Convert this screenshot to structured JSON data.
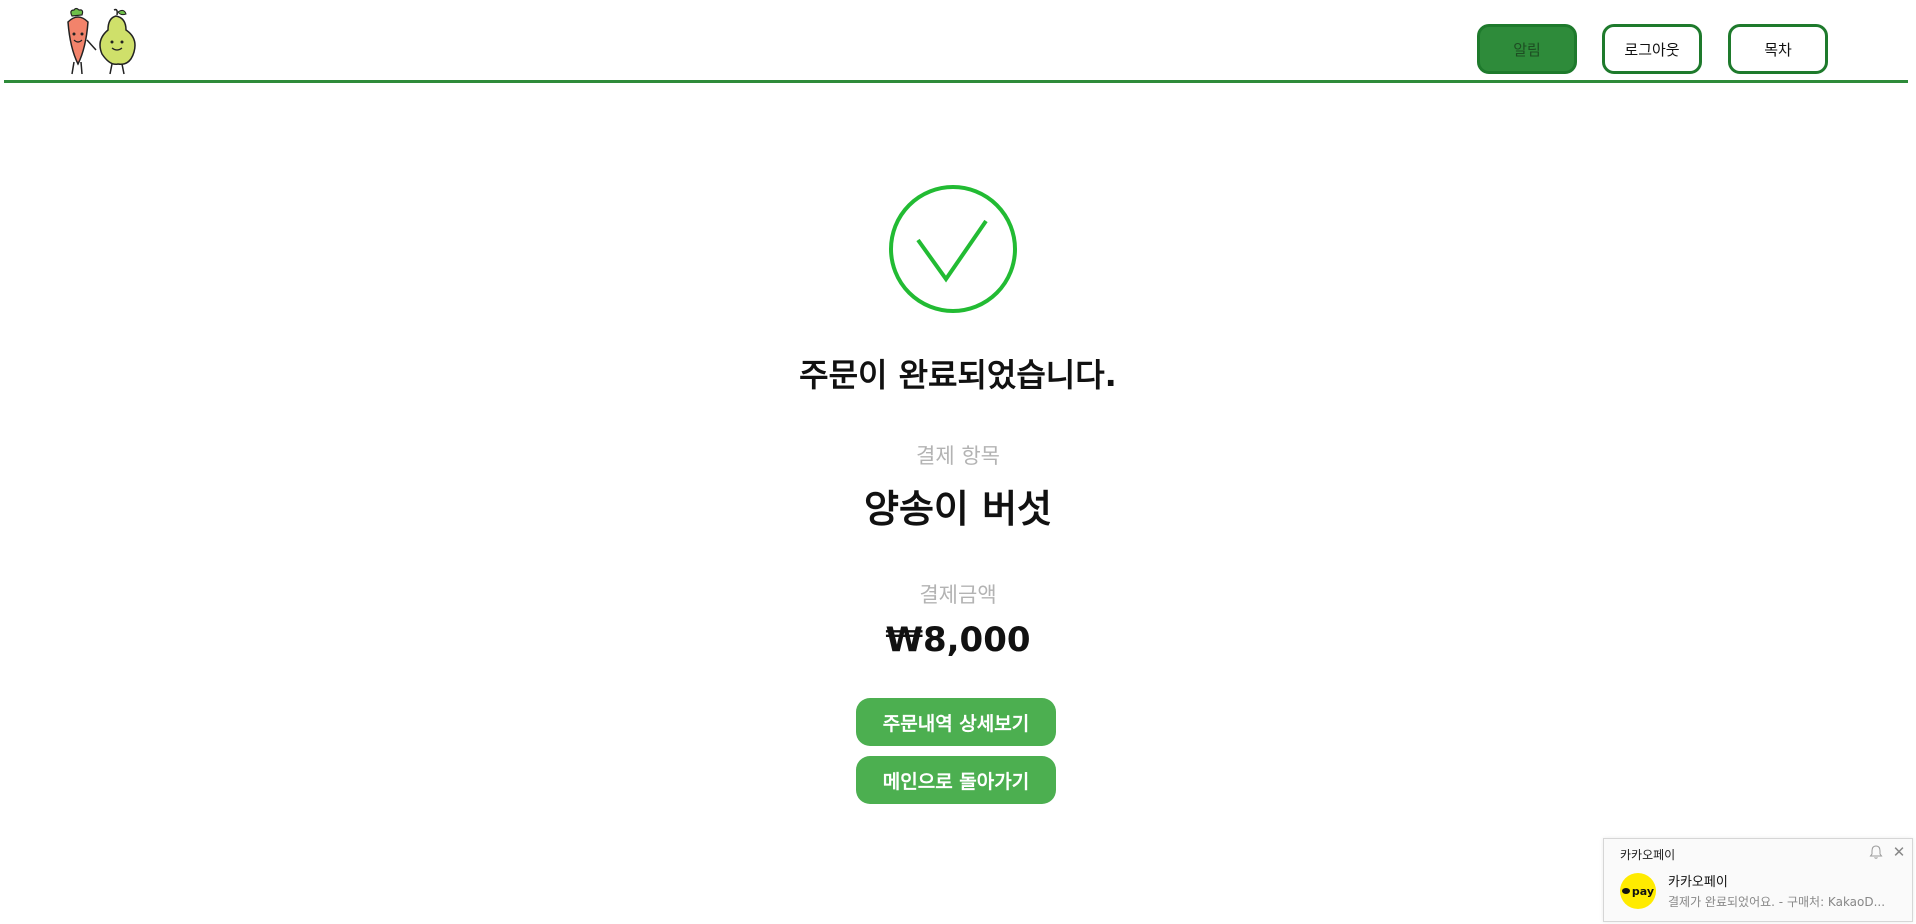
{
  "header": {
    "logo": "carrot-and-pear-logo",
    "nav": {
      "alarm_label": "알림",
      "logout_label": "로그아웃",
      "toc_label": "목차"
    }
  },
  "main": {
    "status_icon": "check-circle-icon",
    "title": "주문이 완료되었습니다.",
    "item_label": "결제 항목",
    "item_value": "양송이 버섯",
    "amount_label": "결제금액",
    "amount_value": "₩8,000",
    "detail_button": "주문내역 상세보기",
    "main_button": "메인으로 돌아가기"
  },
  "toast": {
    "app_name": "카카오페이",
    "icon_text": "pay",
    "sender": "카카오페이",
    "message": "결제가 완료되었어요.  - 구매처: KakaoD..."
  },
  "colors": {
    "brand_green": "#2e8b3a",
    "button_green": "#4caf50",
    "check_green": "#22bb33",
    "muted_text": "#b3b3b3",
    "kakao_yellow": "#ffeb00"
  }
}
